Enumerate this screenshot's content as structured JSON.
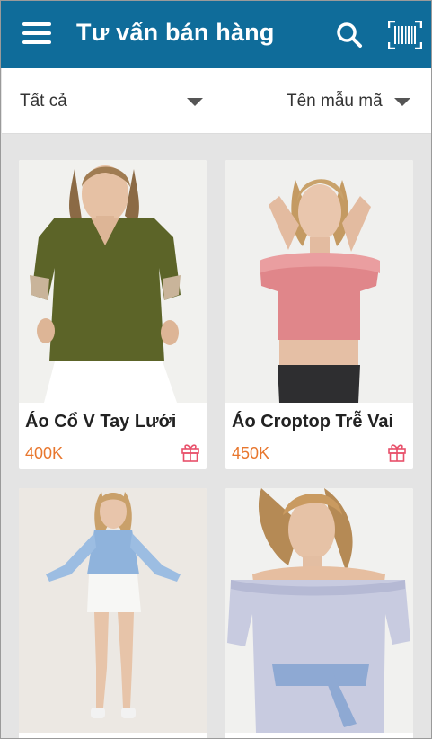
{
  "header": {
    "title": "Tư vấn bán hàng",
    "menu_icon": "hamburger-menu-icon",
    "search_icon": "search-icon",
    "barcode_icon": "barcode-scan-icon",
    "color": "#0f6c9a"
  },
  "filters": {
    "category": "Tất cả",
    "sort": "Tên mẫu mã"
  },
  "products": [
    {
      "name": "Áo Cổ V Tay Lưới",
      "price": "400K",
      "icon": "gift-icon"
    },
    {
      "name": "Áo Croptop Trễ Vai",
      "price": "450K",
      "icon": "gift-icon"
    },
    {
      "name": "",
      "price": ""
    },
    {
      "name": "",
      "price": ""
    }
  ],
  "colors": {
    "price": "#e8772e",
    "gift": "#e8506a"
  }
}
